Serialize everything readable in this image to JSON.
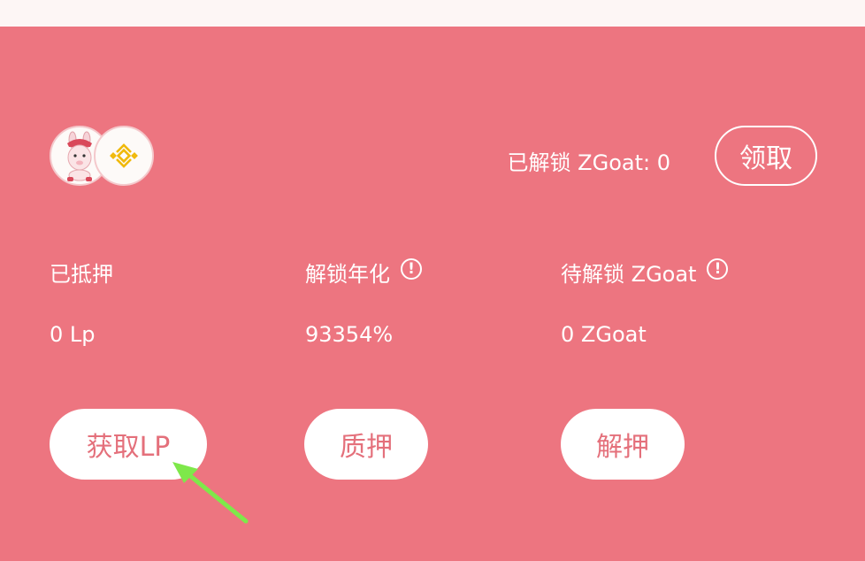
{
  "header": {
    "unlocked_text": "已解锁 ZGoat: 0",
    "claim_label": "领取"
  },
  "stats": [
    {
      "label": "已抵押",
      "value": "0 Lp"
    },
    {
      "label": "解锁年化",
      "value": "93354%"
    },
    {
      "label": "待解锁 ZGoat",
      "value": "0 ZGoat"
    }
  ],
  "buttons": {
    "get_lp": "获取LP",
    "stake": "质押",
    "unstake": "解押"
  },
  "icons": {
    "token_a": "goat-icon",
    "token_b": "bnb-icon",
    "info": "info-icon",
    "pointer": "green-arrow-icon"
  },
  "colors": {
    "background": "#ed7580",
    "button_text": "#e4707b",
    "bnb": "#f0b90b",
    "arrow": "#7ee84a"
  }
}
